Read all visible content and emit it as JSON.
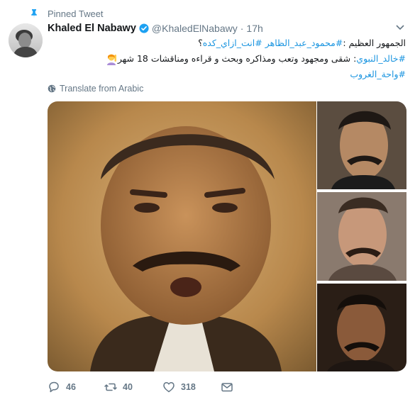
{
  "pinned": {
    "label": "Pinned Tweet",
    "icon": "pin-icon"
  },
  "author": {
    "name": "Khaled El Nabawy",
    "handle": "@KhaledElNabawy",
    "separator": "·",
    "time": "17h",
    "verified": true
  },
  "tweet": {
    "line1_prefix": "الجمهور العظيم : ",
    "line1_tag1": "#محمود_عبد_الظاهر",
    "line1_tag2": "#انت_ازاي_كده",
    "line1_suffix": " ؟",
    "line2_tag": "#خالد_النبوي",
    "line2_text": " : شقى ومجهود وتعب ومذاكره وبحث و قراءه ومناقشات  18 شهر ",
    "line3_tag": "#واحة_الغروب",
    "emoji": "person-raising-hand"
  },
  "translate": {
    "label": "Translate from Arabic",
    "icon": "globe-icon"
  },
  "actions": {
    "reply_count": "46",
    "retweet_count": "40",
    "like_count": "318"
  },
  "colors": {
    "accent": "#1b95e0",
    "muted": "#657786",
    "verified": "#1da1f2"
  }
}
